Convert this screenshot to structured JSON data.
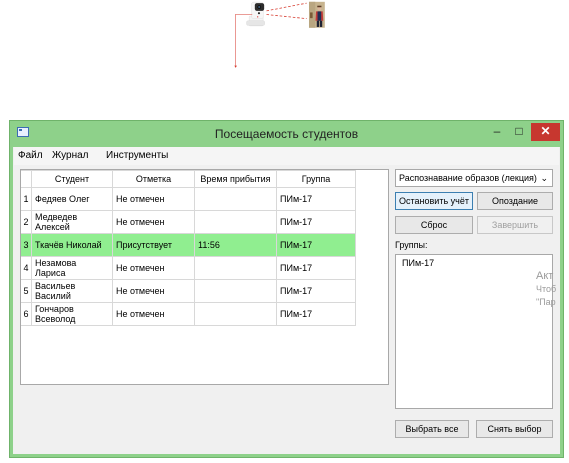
{
  "window": {
    "title": "Посещаемость студентов",
    "minimize_glyph": "–",
    "maximize_glyph": "□",
    "close_glyph": "✕"
  },
  "menu": [
    "Файл",
    "Журнал",
    "Инструменты"
  ],
  "table": {
    "headers": [
      "Студент",
      "Отметка",
      "Время прибытия",
      "Группа"
    ],
    "rows": [
      {
        "num": "1",
        "name": "Федяев Олег",
        "mark": "Не отмечен",
        "time": "",
        "group": "ПИм-17",
        "selected": false
      },
      {
        "num": "2",
        "name": "Медведев Алексей",
        "mark": "Не отмечен",
        "time": "",
        "group": "ПИм-17",
        "selected": false
      },
      {
        "num": "3",
        "name": "Ткачёв Николай",
        "mark": "Присутствует",
        "time": "11:56",
        "group": "ПИм-17",
        "selected": true
      },
      {
        "num": "4",
        "name": "Незамова Лариса",
        "mark": "Не отмечен",
        "time": "",
        "group": "ПИм-17",
        "selected": false
      },
      {
        "num": "5",
        "name": "Васильев Василий",
        "mark": "Не отмечен",
        "time": "",
        "group": "ПИм-17",
        "selected": false
      },
      {
        "num": "6",
        "name": "Гончаров Всеволод",
        "mark": "Не отмечен",
        "time": "",
        "group": "ПИм-17",
        "selected": false
      }
    ]
  },
  "panel": {
    "course": "Распознавание образов (лекция)",
    "stop_button": "Остановить учёт",
    "late_button": "Опоздание",
    "reset_button": "Сброс",
    "finish_button": "Завершить",
    "groups_label": "Группы:",
    "groups": [
      "ПИм-17"
    ],
    "select_all_button": "Выбрать все",
    "deselect_button": "Снять выбор"
  },
  "watermark": {
    "line1": "Акт",
    "line2": "Чтоб",
    "line3": "\"Пар"
  },
  "colors": {
    "titlebar": "#8ed18a",
    "selected_row": "#90ee90",
    "close_button": "#c7372f",
    "connector_line": "#d63b2f"
  },
  "icons": [
    "camera-icon",
    "person-photo",
    "app-icon",
    "chevron-down-icon"
  ]
}
